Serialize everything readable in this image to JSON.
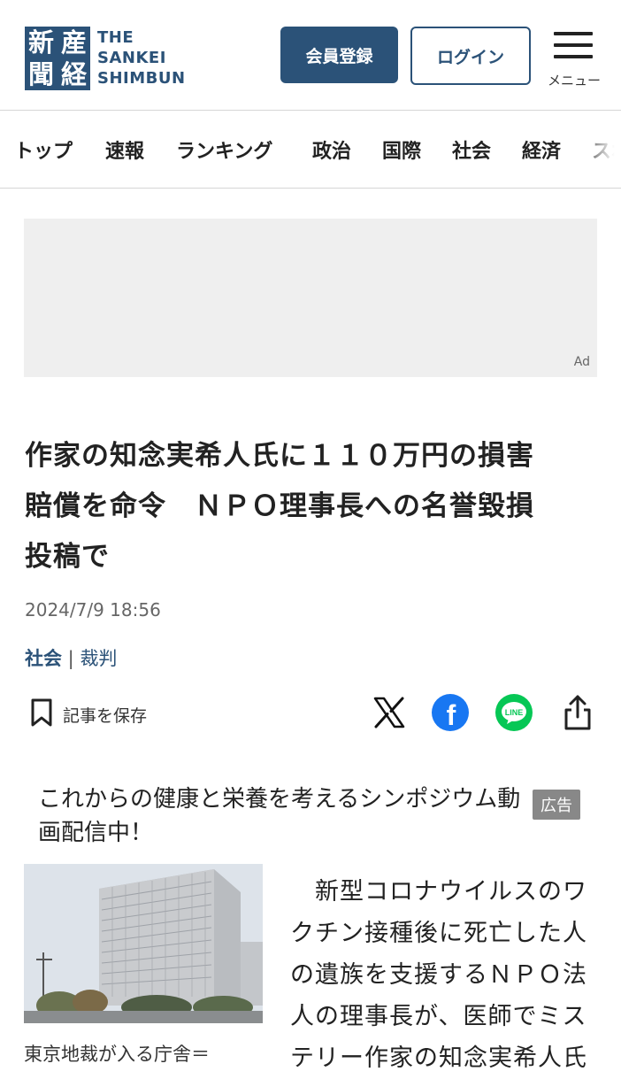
{
  "header": {
    "logo_kanji": [
      "新",
      "産",
      "聞",
      "経"
    ],
    "logo_text": [
      "THE",
      "SANKEI",
      "SHIMBUN"
    ],
    "register_label": "会員登録",
    "login_label": "ログイン",
    "menu_label": "メニュー"
  },
  "nav": {
    "items": [
      "トップ",
      "速報",
      "ランキング",
      "政治",
      "国際",
      "社会",
      "経済",
      "スポ"
    ]
  },
  "ad": {
    "label": "Ad"
  },
  "article": {
    "title_lines": [
      "作家の知念実希人氏に１１０万円の損害",
      "賠償を命令　ＮＰＯ理事長への名誉毀損",
      "投稿で"
    ],
    "date": "2024/7/9 18:56",
    "category_primary": "社会",
    "category_sep": " | ",
    "category_secondary": "裁判",
    "save_label": "記事を保存",
    "share_x_letter": "X",
    "share_fb_letter": "f",
    "share_line_text": "LINE"
  },
  "sponsored": {
    "text": "これからの健康と栄養を考えるシンポジウム動画配信中！",
    "badge": "広告"
  },
  "photo": {
    "caption": "東京地裁が入る庁舎＝"
  },
  "body": {
    "lines": [
      "　新型コロナウイルスのワ",
      "クチン接種後に死亡した人",
      "の遺族を支援するＮＰＯ法",
      "人の理事長が、医師でミス",
      "テリー作家の知念実希人氏"
    ]
  },
  "colors": {
    "brand_navy": "#2b5278",
    "facebook": "#1877f2",
    "line": "#06c755"
  }
}
